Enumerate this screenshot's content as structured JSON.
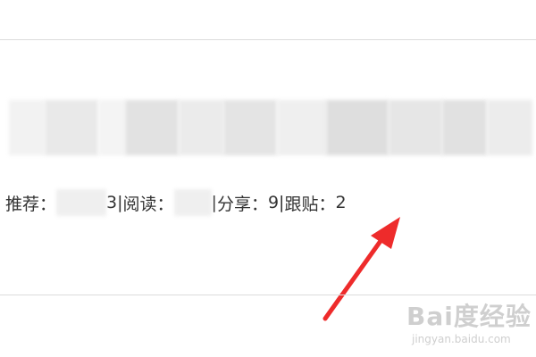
{
  "stats": {
    "recommend_label": "推荐：",
    "recommend_value_tail": "3",
    "read_label": "阅读：",
    "share_label": "分享：",
    "share_value": "9",
    "reply_label": "跟贴：",
    "reply_value": "2",
    "separator": " | "
  },
  "colors": {
    "annotation_arrow": "#ee2b2b",
    "text": "#333333",
    "divider": "#dcdcdc",
    "watermark": "#cfcfcf"
  },
  "watermark": {
    "logo": "Bai度经验",
    "url": "jingyan.baidu.com"
  }
}
